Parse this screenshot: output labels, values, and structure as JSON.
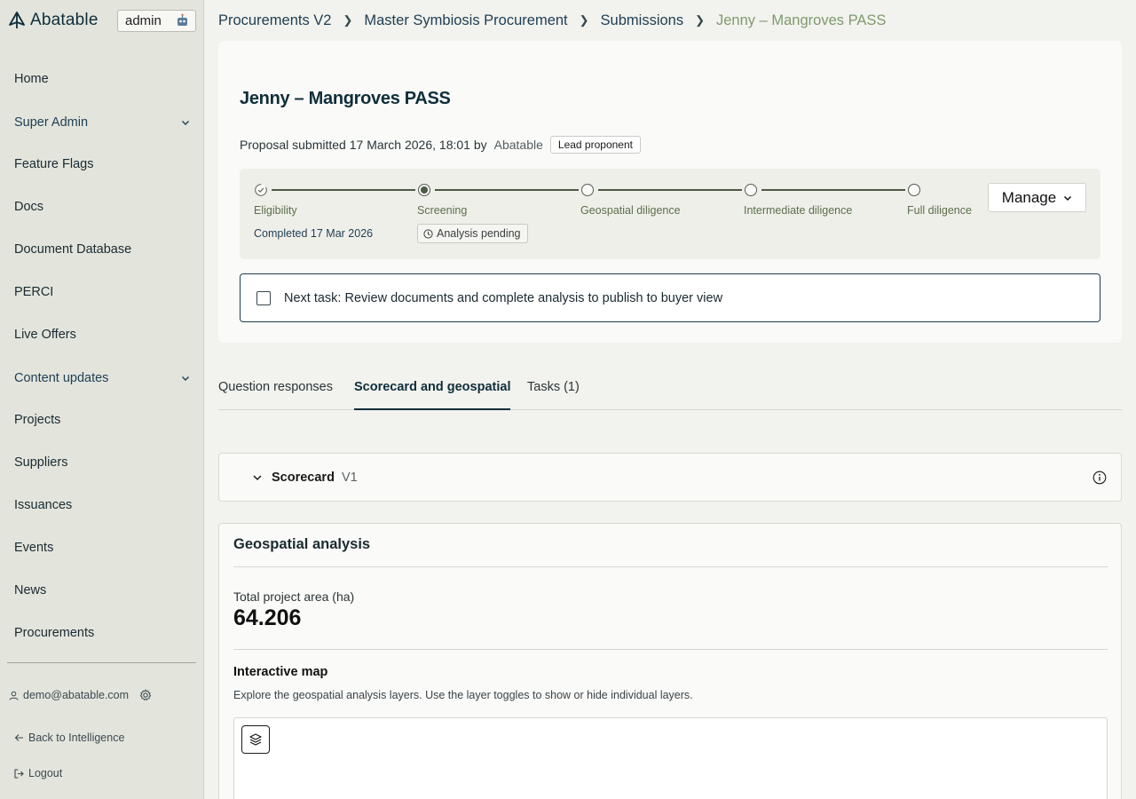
{
  "brand": {
    "name": "Abatable",
    "logo_icon": "abatable-logo-icon"
  },
  "admin_badge": {
    "label": "admin",
    "icon": "robot-icon"
  },
  "sidebar": {
    "items": [
      {
        "label": "Home"
      },
      {
        "label": "Super Admin",
        "expandable": true
      },
      {
        "label": "Feature Flags"
      },
      {
        "label": "Docs"
      },
      {
        "label": "Document Database"
      },
      {
        "label": "PERCI"
      },
      {
        "label": "Live Offers"
      },
      {
        "label": "Content updates",
        "expandable": true
      },
      {
        "label": "Projects"
      },
      {
        "label": "Suppliers"
      },
      {
        "label": "Issuances"
      },
      {
        "label": "Events"
      },
      {
        "label": "News"
      },
      {
        "label": "Procurements"
      }
    ],
    "footer": {
      "user_email": "demo@abatable.com",
      "back_label": "Back to Intelligence",
      "logout_label": "Logout"
    }
  },
  "breadcrumb": {
    "items": [
      "Procurements V2",
      "Master Symbiosis Procurement",
      "Submissions"
    ],
    "current": "Jenny – Mangroves PASS"
  },
  "header": {
    "title": "Jenny – Mangroves PASS",
    "submitted_text": "Proposal submitted 17 March 2026, 18:01 by",
    "submitted_by": "Abatable",
    "role_badge": "Lead proponent"
  },
  "stepper": {
    "steps": [
      {
        "label": "Eligibility",
        "state": "completed",
        "sub": "Completed 17 Mar 2026"
      },
      {
        "label": "Screening",
        "state": "current",
        "badge": "Analysis pending"
      },
      {
        "label": "Geospatial diligence",
        "state": "upcoming"
      },
      {
        "label": "Intermediate diligence",
        "state": "upcoming"
      },
      {
        "label": "Full diligence",
        "state": "upcoming"
      }
    ],
    "manage_label": "Manage"
  },
  "next_task": {
    "text": "Next task: Review documents and complete analysis to publish to buyer view",
    "checked": false
  },
  "tabs": [
    {
      "label": "Question responses",
      "active": false
    },
    {
      "label": "Scorecard and geospatial",
      "active": true
    },
    {
      "label": "Tasks (1)",
      "active": false
    }
  ],
  "scorecard": {
    "title": "Scorecard",
    "version": "V1"
  },
  "geospatial": {
    "title": "Geospatial analysis",
    "area_label": "Total project area (ha)",
    "area_value": "64.206",
    "map_title": "Interactive map",
    "map_description": "Explore the geospatial analysis layers. Use the layer toggles to show or hide individual layers."
  },
  "colors": {
    "sidebar_bg": "#e3e5dd",
    "page_bg": "#f2f2ee",
    "primary_text": "#0f2e3a",
    "accent_green": "#7e9a6e",
    "stepper_line": "#4d5a44"
  }
}
